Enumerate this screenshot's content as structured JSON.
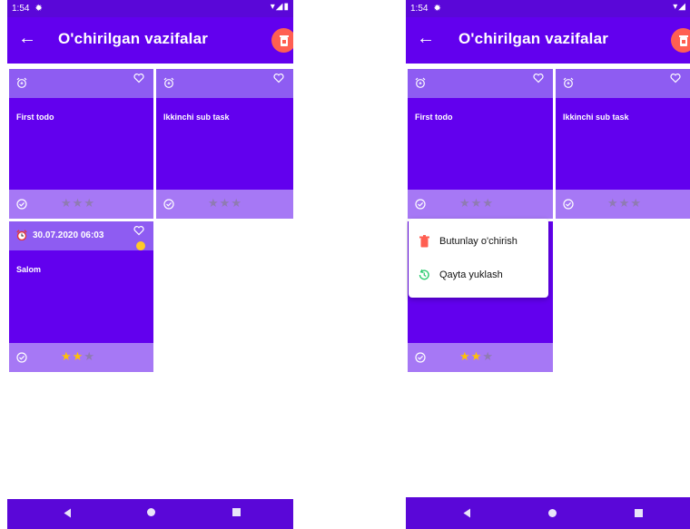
{
  "status": {
    "time": "1:54"
  },
  "appbar": {
    "title": "O'chirilgan vazifalar"
  },
  "tasks": [
    {
      "title": "First todo",
      "stars_filled": 0,
      "stars_total": 3,
      "star": "★"
    },
    {
      "title": "Ikkinchi sub task",
      "stars_filled": 0,
      "stars_total": 3,
      "star": "★"
    },
    {
      "title": "Salom",
      "date": "30.07.2020 06:03",
      "stars_filled": 2,
      "stars_total": 3,
      "star": "★"
    }
  ],
  "menu": {
    "delete_label": "Butunlay o'chirish",
    "restore_label": "Qayta yuklash"
  },
  "colors": {
    "primary": "#6200ee",
    "status_bar": "#5a07d8",
    "card": "#6200ee",
    "delete_red": "#ff5f52",
    "star_gold": "#ffc107",
    "restore_green": "#2ecc71"
  }
}
